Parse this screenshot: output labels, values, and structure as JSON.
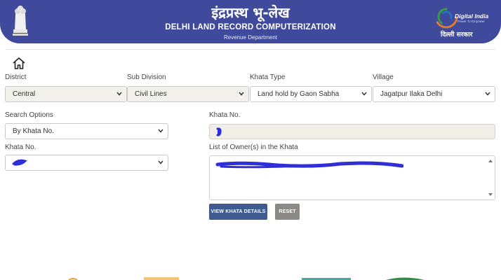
{
  "header": {
    "title_hindi": "इंद्रप्रस्थ भू-लेख",
    "title": "DELHI LAND RECORD COMPUTERIZATION",
    "subtitle": "Revenue Department",
    "right_logo": {
      "title": "Digital India",
      "tagline": "Power To Empower",
      "hindi": "दिल्ली सरकार"
    }
  },
  "filters": {
    "district": {
      "label": "District",
      "value": "Central"
    },
    "sub_division": {
      "label": "Sub Division",
      "value": "Civil Lines"
    },
    "khata_type": {
      "label": "Khata Type",
      "value": "Land hold by Gaon Sabha"
    },
    "village": {
      "label": "Village",
      "value": "Jagatpur Ilaka Delhi"
    }
  },
  "search": {
    "options_label": "Search Options",
    "options_value": "By Khata No.",
    "khata_select_label": "Khata No.",
    "khata_input_label": "Khata No.",
    "owners_label": "List of Owner(s) in the Khata"
  },
  "buttons": {
    "view": "VIEW KHATA DETAILS",
    "reset": "RESET"
  },
  "icons": {
    "home": "home-icon",
    "chevron": "chevron-down-icon"
  },
  "colors": {
    "header_bg": "#3f4a9c",
    "primary_button": "#3e5a8e",
    "reset_button": "#8c8a86",
    "redaction": "#2f2fd8"
  }
}
